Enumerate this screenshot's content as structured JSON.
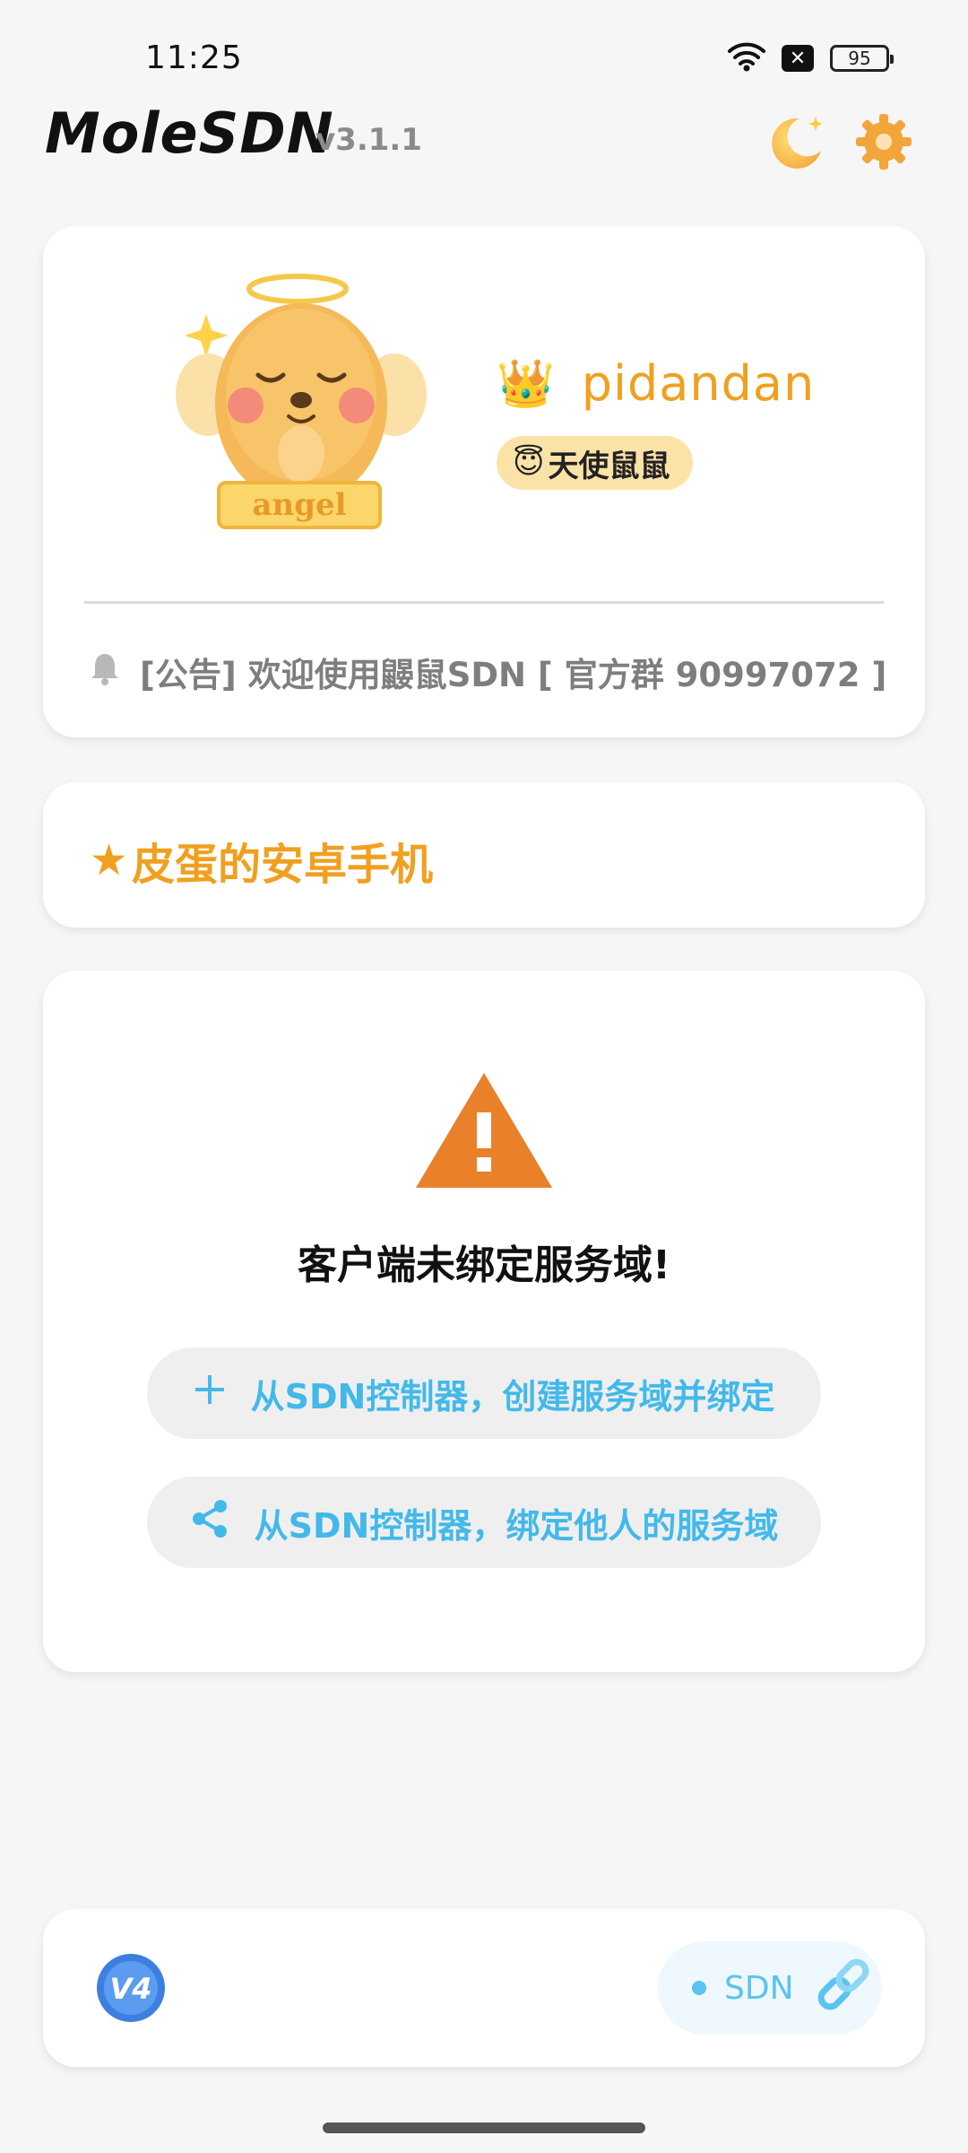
{
  "status_bar": {
    "time": "11:25",
    "battery": "95",
    "icons": [
      "wifi-icon",
      "sim-off-icon",
      "battery-icon"
    ]
  },
  "header": {
    "title": "MoleSDN",
    "version": "v3.1.1",
    "icons": [
      "moon-icon",
      "gear-icon"
    ]
  },
  "profile": {
    "username": "pidandan",
    "badge": "天使鼠鼠",
    "badge_emoji": "😇",
    "crown": "👑",
    "mascot_label": "angel",
    "notice": "[公告] 欢迎使用鼹鼠SDN [ 官方群 90997072 ]"
  },
  "device": {
    "star": "★",
    "name": "皮蛋的安卓手机"
  },
  "warning": {
    "message": "客户端未绑定服务域!",
    "buttons": {
      "create": "从SDN控制器，创建服务域并绑定",
      "bind": "从SDN控制器，绑定他人的服务域"
    }
  },
  "bottom": {
    "v4_label": "V4",
    "sdn_label": "SDN"
  },
  "colors": {
    "accent_orange": "#f0a020",
    "accent_blue": "#43b9ea",
    "warning": "#e8812a",
    "background": "#f6f6f6"
  }
}
